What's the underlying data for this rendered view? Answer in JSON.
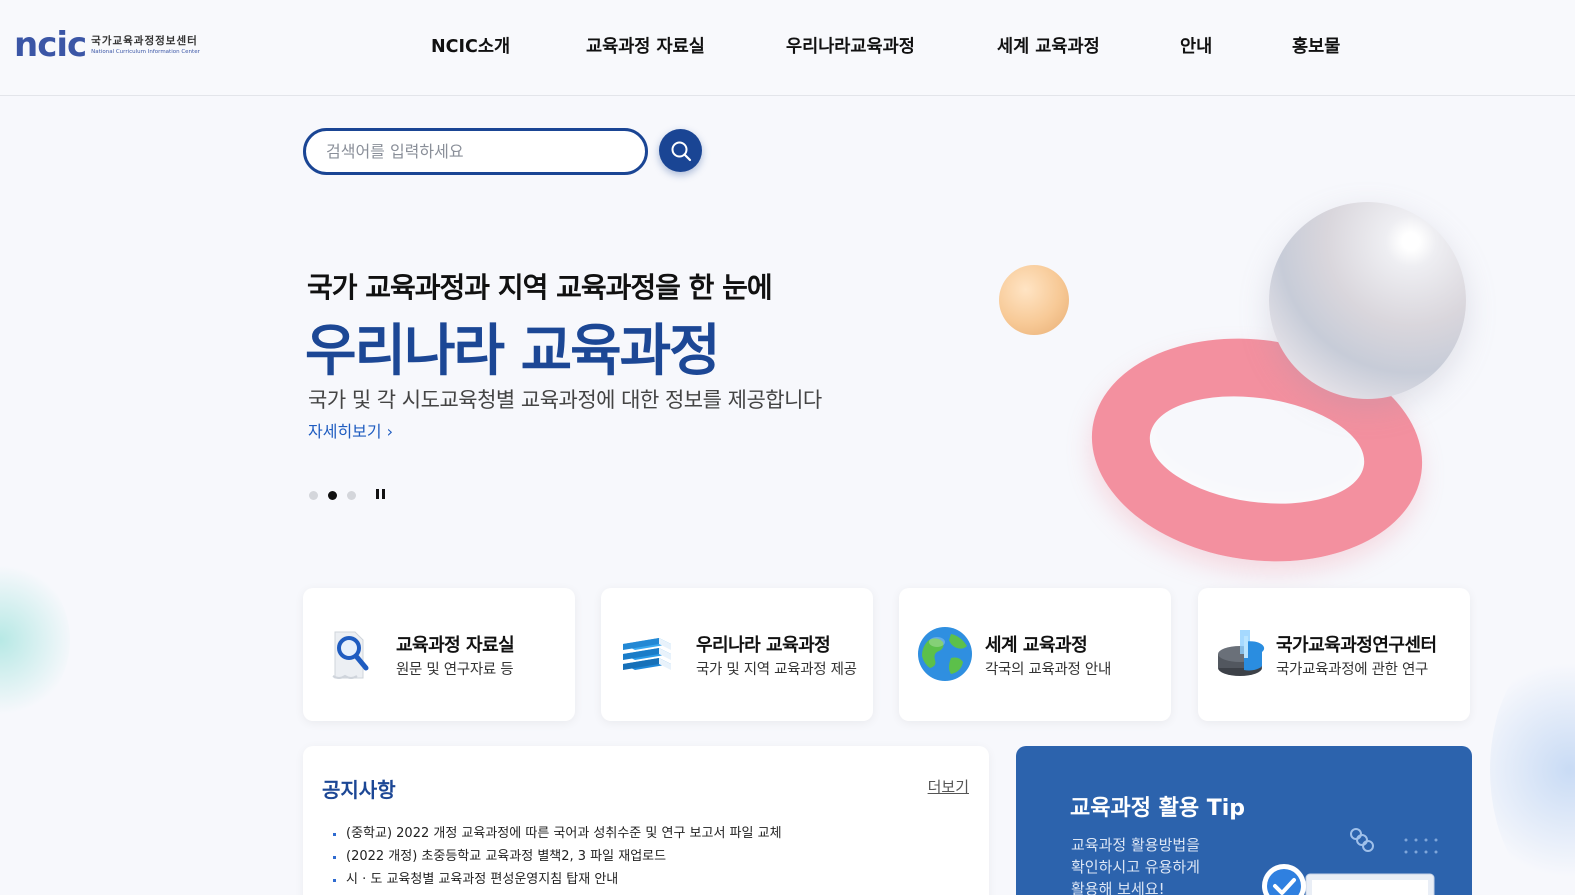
{
  "header": {
    "logo": {
      "mark": "ncic",
      "kr": "국가교육과정정보센터",
      "en": "National Curriculum Information Center"
    },
    "nav": [
      "NCIC소개",
      "교육과정 자료실",
      "우리나라교육과정",
      "세계 교육과정",
      "안내",
      "홍보물"
    ]
  },
  "search": {
    "placeholder": "검색어를 입력하세요",
    "button_icon": "search-icon"
  },
  "hero": {
    "subtitle": "국가 교육과정과 지역 교육과정을 한 눈에",
    "title": "우리나라 교육과정",
    "description": "국가 및 각 시도교육청별 교육과정에 대한 정보를 제공합니다",
    "more": "자세히보기 ›",
    "slides": {
      "count": 3,
      "active": 2
    }
  },
  "cards": [
    {
      "title": "교육과정 자료실",
      "desc": "원문 및 연구자료 등",
      "icon": "magnifier-document-icon"
    },
    {
      "title": "우리나라 교육과정",
      "desc": "국가 및 지역 교육과정 제공",
      "icon": "books-icon"
    },
    {
      "title": "세계 교육과정",
      "desc": "각국의 교육과정 안내",
      "icon": "globe-icon"
    },
    {
      "title": "국가교육과정연구센터",
      "desc": "국가교육과정에 관한 연구",
      "icon": "chart-icon"
    }
  ],
  "notice": {
    "title": "공지사항",
    "more": "더보기",
    "items": [
      "(중학교) 2022 개정 교육과정에 따른 국어과 성취수준 및 연구 보고서 파일 교체",
      "(2022 개정) 초중등학교 교육과정 별책2, 3 파일 재업로드",
      "시 · 도 교육청별 교육과정 편성운영지침 탑재 안내"
    ]
  },
  "tip": {
    "title": "교육과정 활용 Tip",
    "lines": [
      "교육과정 활용방법을",
      "확인하시고 유용하게",
      "활용해 보세요!"
    ]
  },
  "colors": {
    "primary": "#1c4795",
    "tip_bg": "#2c63ad",
    "link": "#1f5cc0"
  }
}
